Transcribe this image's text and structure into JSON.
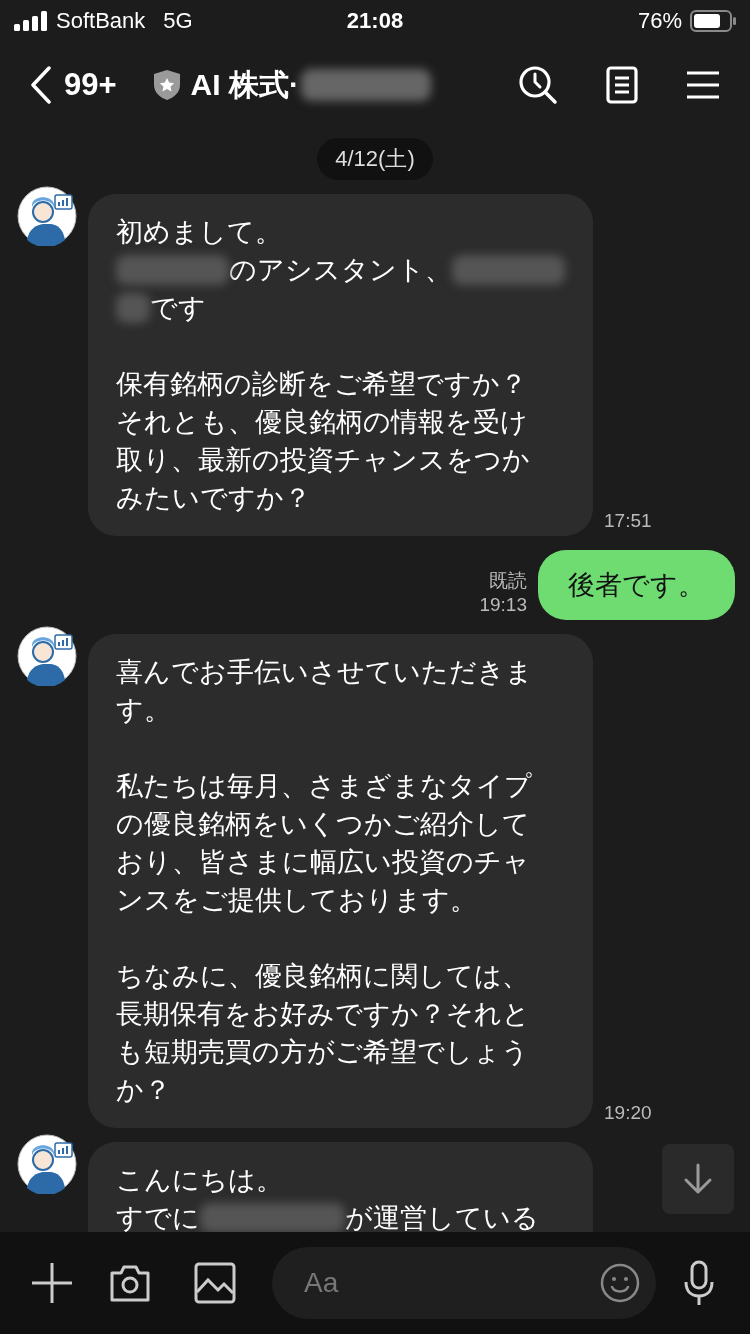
{
  "status_bar": {
    "carrier": "SoftBank",
    "network": "5G",
    "time": "21:08",
    "battery": "76%"
  },
  "header": {
    "back_count": "99+",
    "title": "AI 株式·"
  },
  "date": "4/12(土)",
  "messages": [
    {
      "kind": "received",
      "time": "17:51",
      "paragraphs": [
        {
          "lines": [
            {
              "segments": [
                {
                  "kind": "text",
                  "text": "初めまして。"
                }
              ]
            },
            {
              "segments": [
                {
                  "kind": "redacted"
                },
                {
                  "kind": "text",
                  "text": "のアシスタント、"
                },
                {
                  "kind": "redacted"
                }
              ]
            },
            {
              "segments": [
                {
                  "kind": "redacted_short"
                },
                {
                  "kind": "text",
                  "text": "です"
                }
              ]
            }
          ]
        },
        {
          "lines": [
            {
              "segments": [
                {
                  "kind": "text",
                  "text": "保有銘柄の診断をご希望ですか？"
                }
              ]
            },
            {
              "segments": [
                {
                  "kind": "text",
                  "text": "それとも、優良銘柄の情報を受け"
                }
              ]
            },
            {
              "segments": [
                {
                  "kind": "text",
                  "text": "取り、最新の投資チャンスをつか"
                }
              ]
            },
            {
              "segments": [
                {
                  "kind": "text",
                  "text": "みたいですか？"
                }
              ]
            }
          ]
        }
      ]
    },
    {
      "kind": "sent",
      "read": "既読",
      "time": "19:13",
      "paragraphs": [
        {
          "lines": [
            {
              "segments": [
                {
                  "kind": "text",
                  "text": "後者です。"
                }
              ]
            }
          ]
        }
      ]
    },
    {
      "kind": "received",
      "time": "19:20",
      "paragraphs": [
        {
          "lines": [
            {
              "segments": [
                {
                  "kind": "text",
                  "text": "喜んでお手伝いさせていただきま"
                }
              ]
            },
            {
              "segments": [
                {
                  "kind": "text",
                  "text": "す。"
                }
              ]
            }
          ]
        },
        {
          "lines": [
            {
              "segments": [
                {
                  "kind": "text",
                  "text": "私たちは毎月、さまざまなタイプ"
                }
              ]
            },
            {
              "segments": [
                {
                  "kind": "text",
                  "text": "の優良銘柄をいくつかご紹介して"
                }
              ]
            },
            {
              "segments": [
                {
                  "kind": "text",
                  "text": "おり、皆さまに幅広い投資のチャ"
                }
              ]
            },
            {
              "segments": [
                {
                  "kind": "text",
                  "text": "ンスをご提供しております。"
                }
              ]
            }
          ]
        },
        {
          "lines": [
            {
              "segments": [
                {
                  "kind": "text",
                  "text": "ちなみに、優良銘柄に関しては、"
                }
              ]
            },
            {
              "segments": [
                {
                  "kind": "text",
                  "text": "長期保有をお好みですか？それと"
                }
              ]
            },
            {
              "segments": [
                {
                  "kind": "text",
                  "text": "も短期売買の方がご希望でしょう"
                }
              ]
            },
            {
              "segments": [
                {
                  "kind": "text",
                  "text": "か？"
                }
              ]
            }
          ]
        }
      ]
    },
    {
      "kind": "received",
      "paragraphs": [
        {
          "lines": [
            {
              "segments": [
                {
                  "kind": "text",
                  "text": "こんにちは。"
                }
              ]
            },
            {
              "segments": [
                {
                  "kind": "text",
                  "text": "すでに"
                },
                {
                  "kind": "redacted_long"
                },
                {
                  "kind": "text",
                  "text": "が運営している"
                }
              ]
            }
          ]
        }
      ]
    }
  ],
  "composer": {
    "placeholder": "Aa"
  }
}
